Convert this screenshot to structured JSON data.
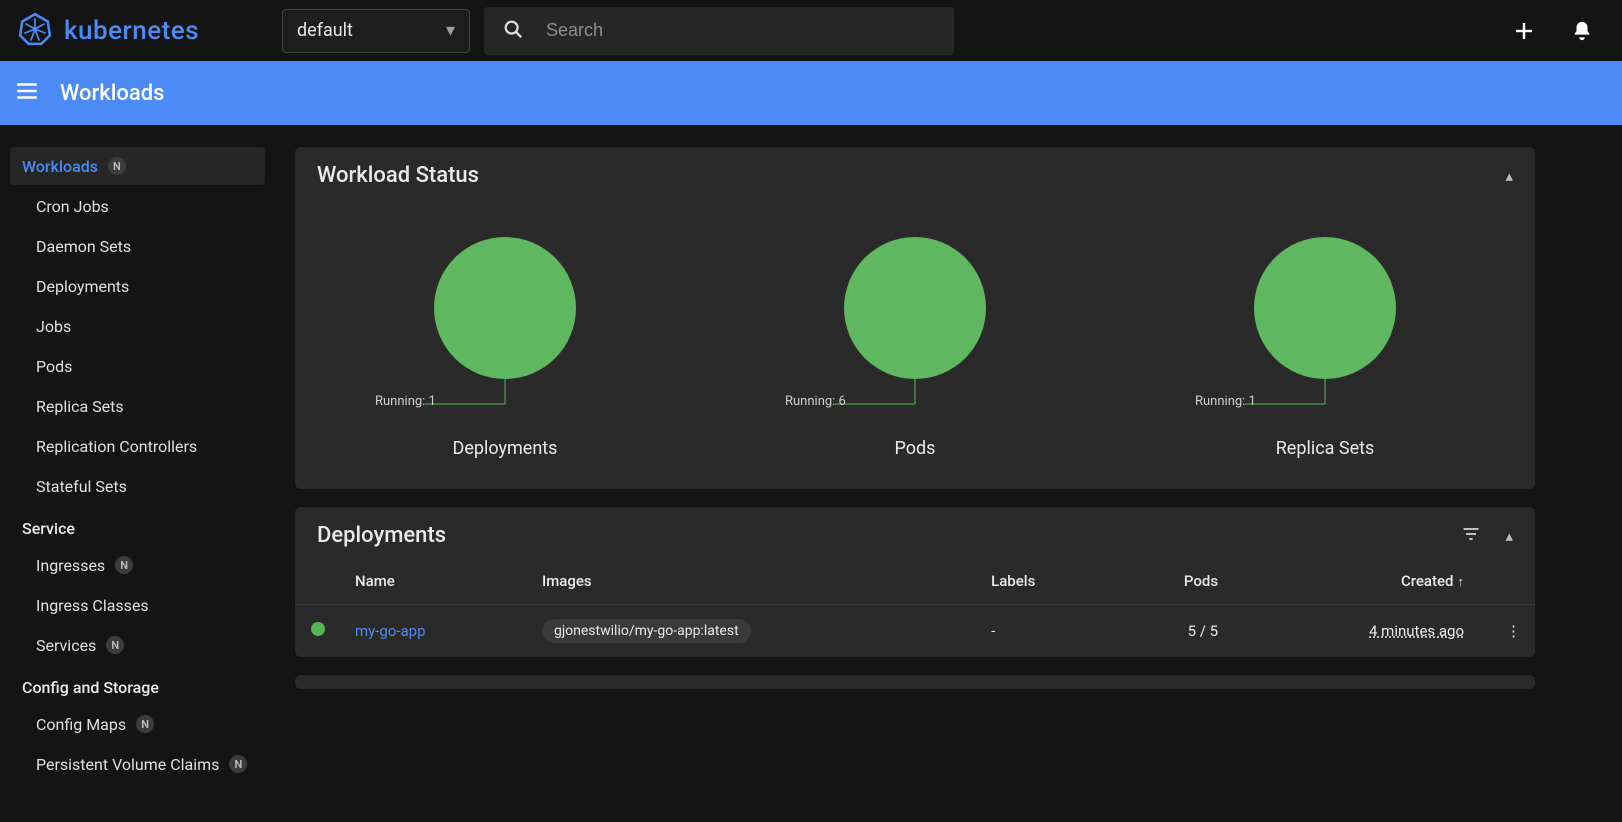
{
  "brand": "kubernetes",
  "namespace": {
    "selected": "default"
  },
  "search": {
    "placeholder": "Search"
  },
  "page_title": "Workloads",
  "sidebar": {
    "top": {
      "label": "Workloads",
      "badge": "N"
    },
    "workload_items": [
      {
        "label": "Cron Jobs"
      },
      {
        "label": "Daemon Sets"
      },
      {
        "label": "Deployments"
      },
      {
        "label": "Jobs"
      },
      {
        "label": "Pods"
      },
      {
        "label": "Replica Sets"
      },
      {
        "label": "Replication Controllers"
      },
      {
        "label": "Stateful Sets"
      }
    ],
    "service_header": "Service",
    "service_items": [
      {
        "label": "Ingresses",
        "badge": "N"
      },
      {
        "label": "Ingress Classes"
      },
      {
        "label": "Services",
        "badge": "N"
      }
    ],
    "config_header": "Config and Storage",
    "config_items": [
      {
        "label": "Config Maps",
        "badge": "N"
      },
      {
        "label": "Persistent Volume Claims",
        "badge": "N"
      }
    ]
  },
  "workload_status": {
    "title": "Workload Status"
  },
  "chart_data": [
    {
      "type": "pie",
      "title": "Deployments",
      "series": [
        {
          "name": "Running",
          "value": 1
        }
      ],
      "label": "Running: 1",
      "color": "#5fb75f"
    },
    {
      "type": "pie",
      "title": "Pods",
      "series": [
        {
          "name": "Running",
          "value": 6
        }
      ],
      "label": "Running: 6",
      "color": "#5fb75f"
    },
    {
      "type": "pie",
      "title": "Replica Sets",
      "series": [
        {
          "name": "Running",
          "value": 1
        }
      ],
      "label": "Running: 1",
      "color": "#5fb75f"
    }
  ],
  "deployments": {
    "title": "Deployments",
    "columns": {
      "name": "Name",
      "images": "Images",
      "labels": "Labels",
      "pods": "Pods",
      "created": "Created"
    },
    "sort_indicator": "↑",
    "rows": [
      {
        "name": "my-go-app",
        "image": "gjonestwilio/my-go-app:latest",
        "labels": "-",
        "pods": "5 / 5",
        "created": "4 minutes ago"
      }
    ]
  }
}
